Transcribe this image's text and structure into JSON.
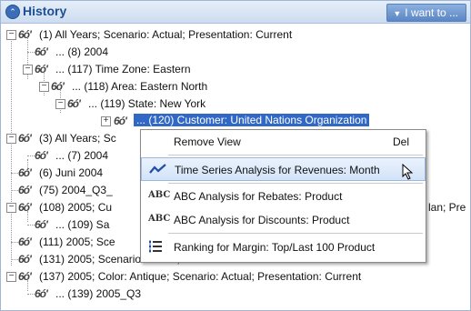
{
  "panel": {
    "title": "History",
    "menu_label": "I want to ..."
  },
  "tree": {
    "rows": [
      {
        "label": "(1) All Years; Scenario: Actual; Presentation: Current"
      },
      {
        "label": "... (8) 2004"
      },
      {
        "label": "... (117) Time Zone: Eastern"
      },
      {
        "label": "... (118) Area: Eastern North"
      },
      {
        "label": "... (119) State: New York"
      },
      {
        "label": "... (120) Customer: United Nations Organization"
      },
      {
        "label": "(3) All Years; Sc"
      },
      {
        "label": "... (7) 2004"
      },
      {
        "label": "(6) Juni 2004"
      },
      {
        "label": "(75) 2004_Q3_"
      },
      {
        "label": "(108) 2005; Cu"
      },
      {
        "label": "... (109) Sa"
      },
      {
        "label": "(111) 2005; Sce"
      },
      {
        "label": "(131) 2005; Scenario: Actual; Presentation: Current"
      },
      {
        "label": "(137) 2005; Color: Antique; Scenario: Actual; Presentation: Current"
      },
      {
        "label": "... (139) 2005_Q3"
      }
    ],
    "trailing_text": "lan; Pre"
  },
  "context_menu": {
    "items": [
      {
        "label": "Remove View",
        "shortcut": "Del",
        "icon": ""
      },
      {
        "label": "Time Series Analysis for Revenues: Month",
        "shortcut": "",
        "icon": "line-chart-icon"
      },
      {
        "label": "ABC Analysis for Rebates: Product",
        "shortcut": "",
        "icon": "abc-icon",
        "icon_text": "ABC"
      },
      {
        "label": "ABC Analysis for Discounts: Product",
        "shortcut": "",
        "icon": "abc-icon",
        "icon_text": "ABC"
      },
      {
        "label": "Ranking for Margin: Top/Last 100 Product",
        "shortcut": "",
        "icon": "ranking-icon"
      }
    ]
  },
  "colors": {
    "header_title": "#1d4f94",
    "selection": "#3168c5",
    "highlight": "#d3e3f8"
  }
}
